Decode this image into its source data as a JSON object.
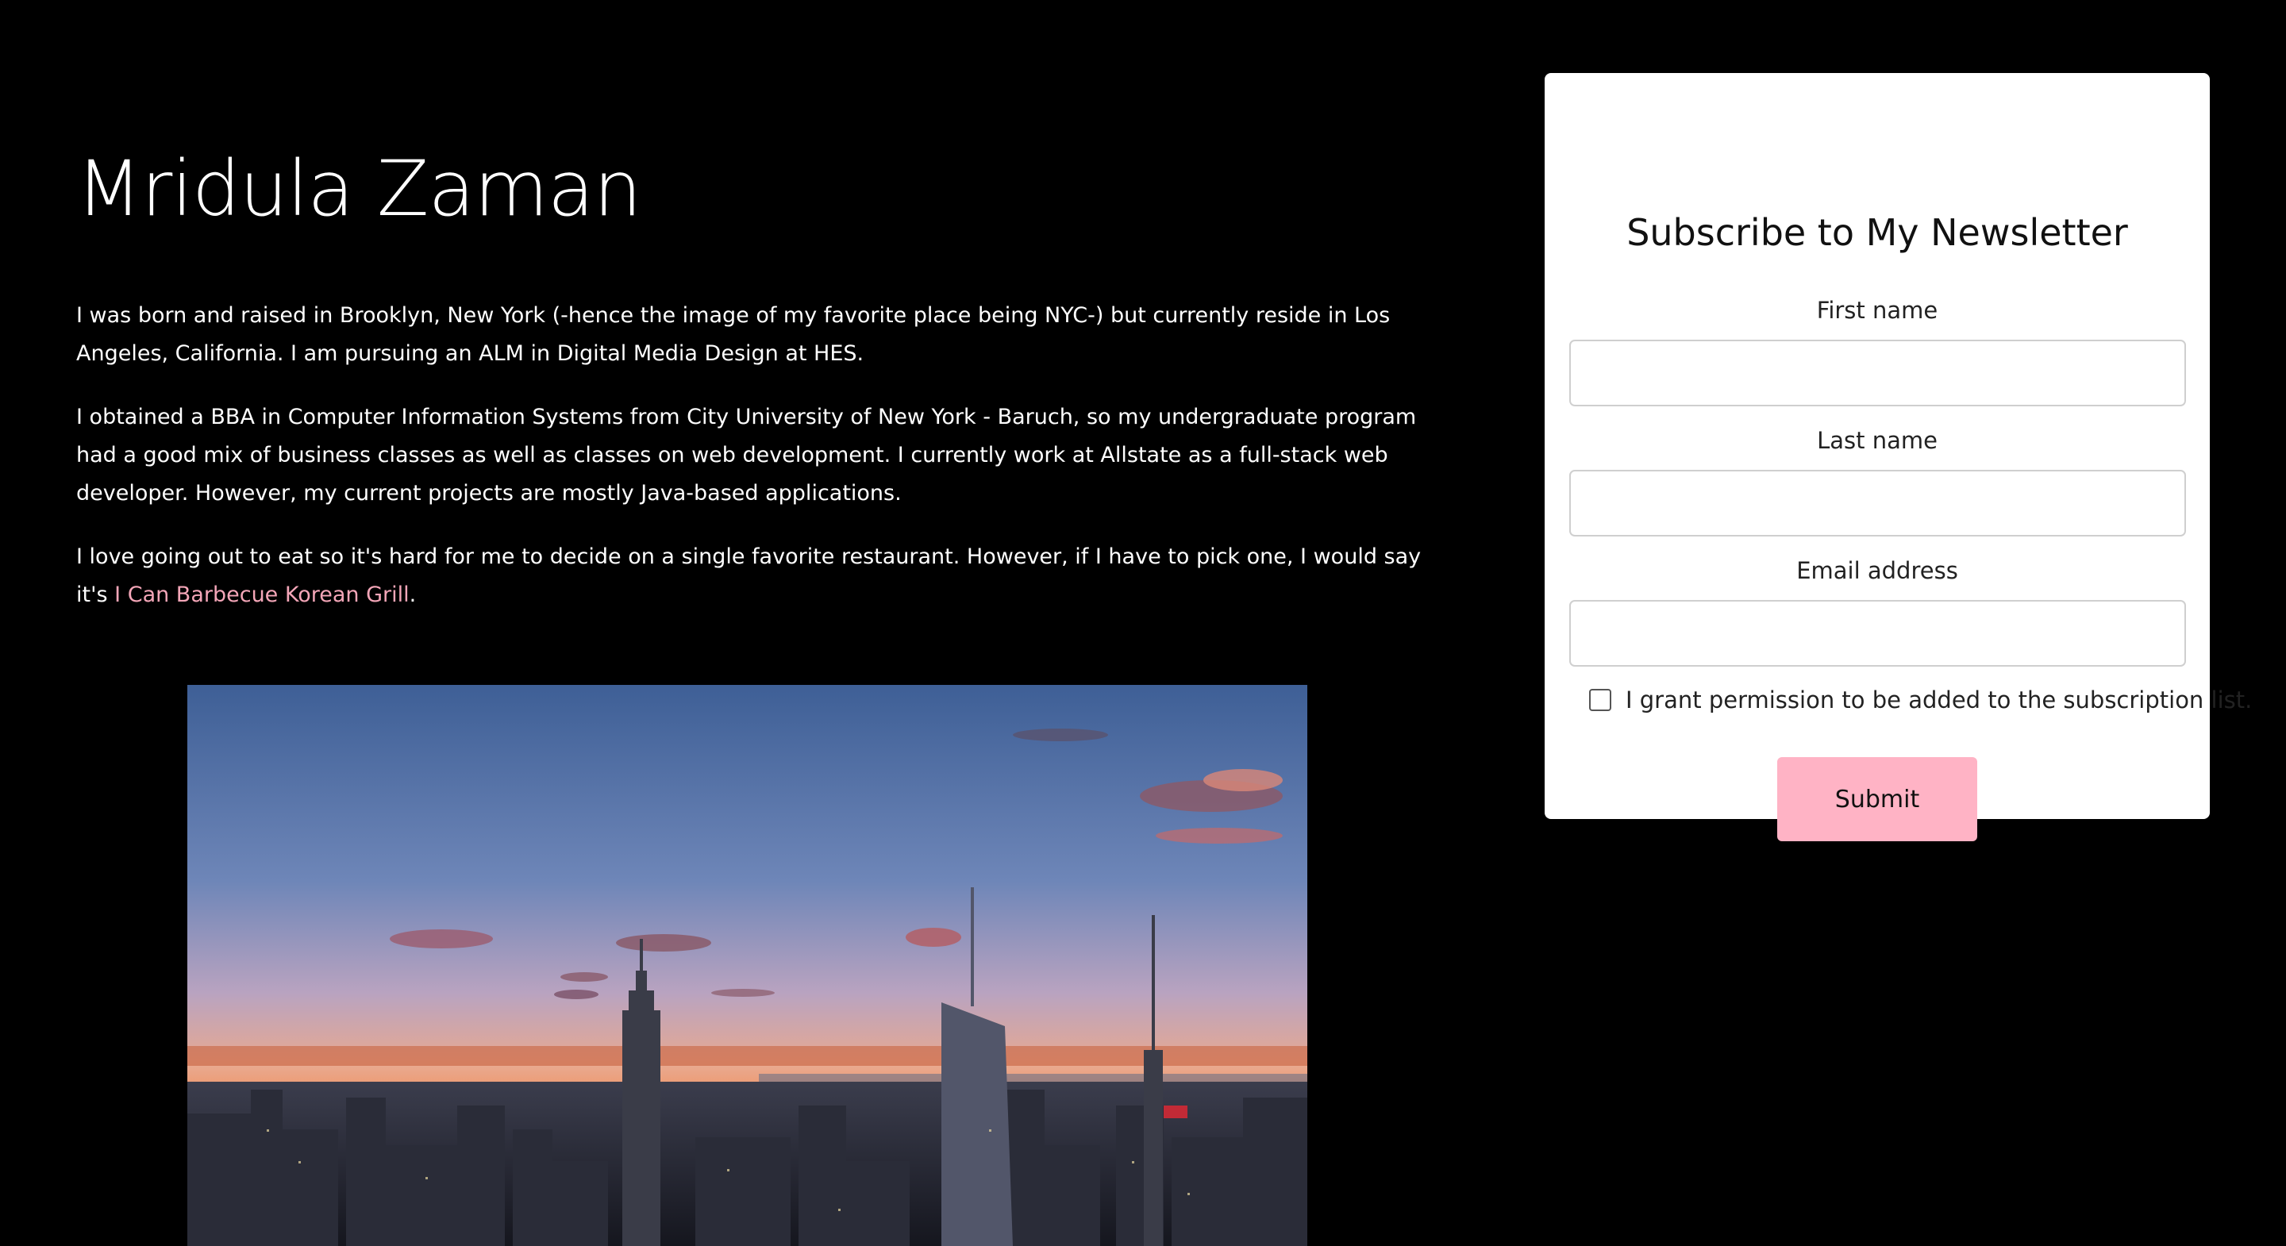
{
  "profile": {
    "name": "Mridula Zaman",
    "bio": {
      "p1": "I was born and raised in Brooklyn, New York (-hence the image of my favorite place being NYC-) but currently reside in Los Angeles, California. I am pursuing an ALM in Digital Media Design at HES.",
      "p2": "I obtained a BBA in Computer Information Systems from City University of New York - Baruch, so my undergraduate program had a good mix of business classes as well as classes on web development. I currently work at Allstate as a full-stack web developer. However, my current projects are mostly Java-based applications.",
      "p3_text": "I love going out to eat so it's hard for me to decide on a single favorite restaurant. However, if I have to pick one, I would say it's ",
      "p3_link": "I Can Barbecue Korean Grill",
      "p3_end": "."
    }
  },
  "newsletter": {
    "title": "Subscribe to My Newsletter",
    "first_name_label": "First name",
    "first_name_value": "",
    "last_name_label": "Last name",
    "last_name_value": "",
    "email_label": "Email address",
    "email_value": "",
    "permission_label": "I grant permission to be added to the subscription list.",
    "permission_checked": false,
    "submit_label": "Submit"
  },
  "colors": {
    "background": "#000000",
    "link": "#f4a6b8",
    "submit_button": "#ffb3c5",
    "card": "#ffffff"
  }
}
